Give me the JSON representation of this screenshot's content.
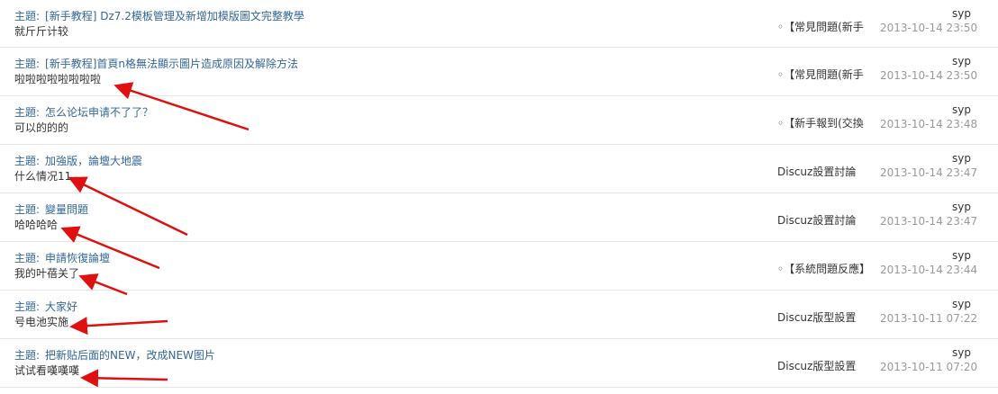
{
  "rows": [
    {
      "prefix": "主題:",
      "title": "[新手教程] Dz7.2模板管理及新增加模版圖文完整教學",
      "reply": "就斤斤计较",
      "forum": "◦【常見問題(新手",
      "user": "syp",
      "date": "2013-10-14 23:50"
    },
    {
      "prefix": "主題:",
      "title": "[新手教程]首頁n格無法顯示圖片造成原因及解除方法",
      "reply": "啦啦啦啦啦啦啦啦",
      "forum": "◦【常見問題(新手",
      "user": "syp",
      "date": "2013-10-14 23:50"
    },
    {
      "prefix": "主題:",
      "title": "怎么论坛申请不了了？",
      "reply": "可以的的的",
      "forum": "◦【新手報到(交換",
      "user": "syp",
      "date": "2013-10-14 23:48"
    },
    {
      "prefix": "主題:",
      "title": "加強版，論壇大地震",
      "reply": "什么情况11",
      "forum": "Discuz設置討論",
      "user": "syp",
      "date": "2013-10-14 23:47"
    },
    {
      "prefix": "主題:",
      "title": "變量問題",
      "reply": "哈哈哈哈",
      "forum": "Discuz設置討論",
      "user": "syp",
      "date": "2013-10-14 23:47"
    },
    {
      "prefix": "主題:",
      "title": "申請恢復論壇",
      "reply": "我的叶蓓关了",
      "forum": "◦【系統問題反應】",
      "user": "syp",
      "date": "2013-10-14 23:44"
    },
    {
      "prefix": "主題:",
      "title": "大家好",
      "reply": "号电池实施",
      "forum": "Discuz版型設置",
      "user": "syp",
      "date": "2013-10-11 07:22"
    },
    {
      "prefix": "主題:",
      "title": "把新贴后面的NEW，改成NEW图片",
      "reply": "试试看嘆嘆嘆",
      "forum": "Discuz版型設置",
      "user": "syp",
      "date": "2013-10-11 07:20"
    }
  ],
  "annotation_color": "#e01010"
}
